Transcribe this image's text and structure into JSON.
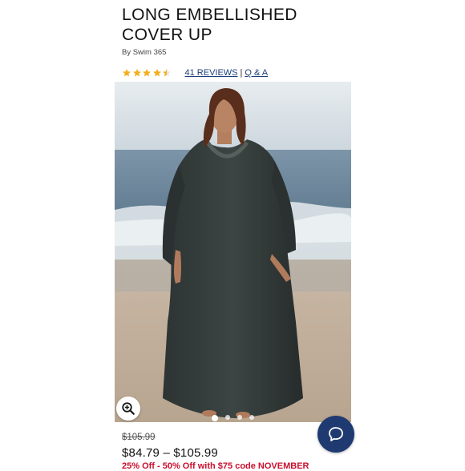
{
  "product": {
    "title_line1": "LONG EMBELLISHED",
    "title_line2": "COVER UP",
    "brand": "By Swim 365",
    "rating": 4.5,
    "reviews_label": "41 REVIEWS",
    "separator": "|",
    "qa_label": "Q & A"
  },
  "gallery": {
    "slide_count": 4,
    "active_slide": 1,
    "zoom_icon": "zoom-in-icon"
  },
  "pricing": {
    "original_price": "$105.99",
    "price_range": "$84.79 – $105.99",
    "promo": "25% Off - 50% Off with $75 code NOVEMBER"
  },
  "chat": {
    "icon": "chat-bubble-icon"
  },
  "colors": {
    "link": "#1c3e7a",
    "star": "#f2b01e",
    "chat_bg": "#1f3a70",
    "promo": "#c8102e"
  }
}
